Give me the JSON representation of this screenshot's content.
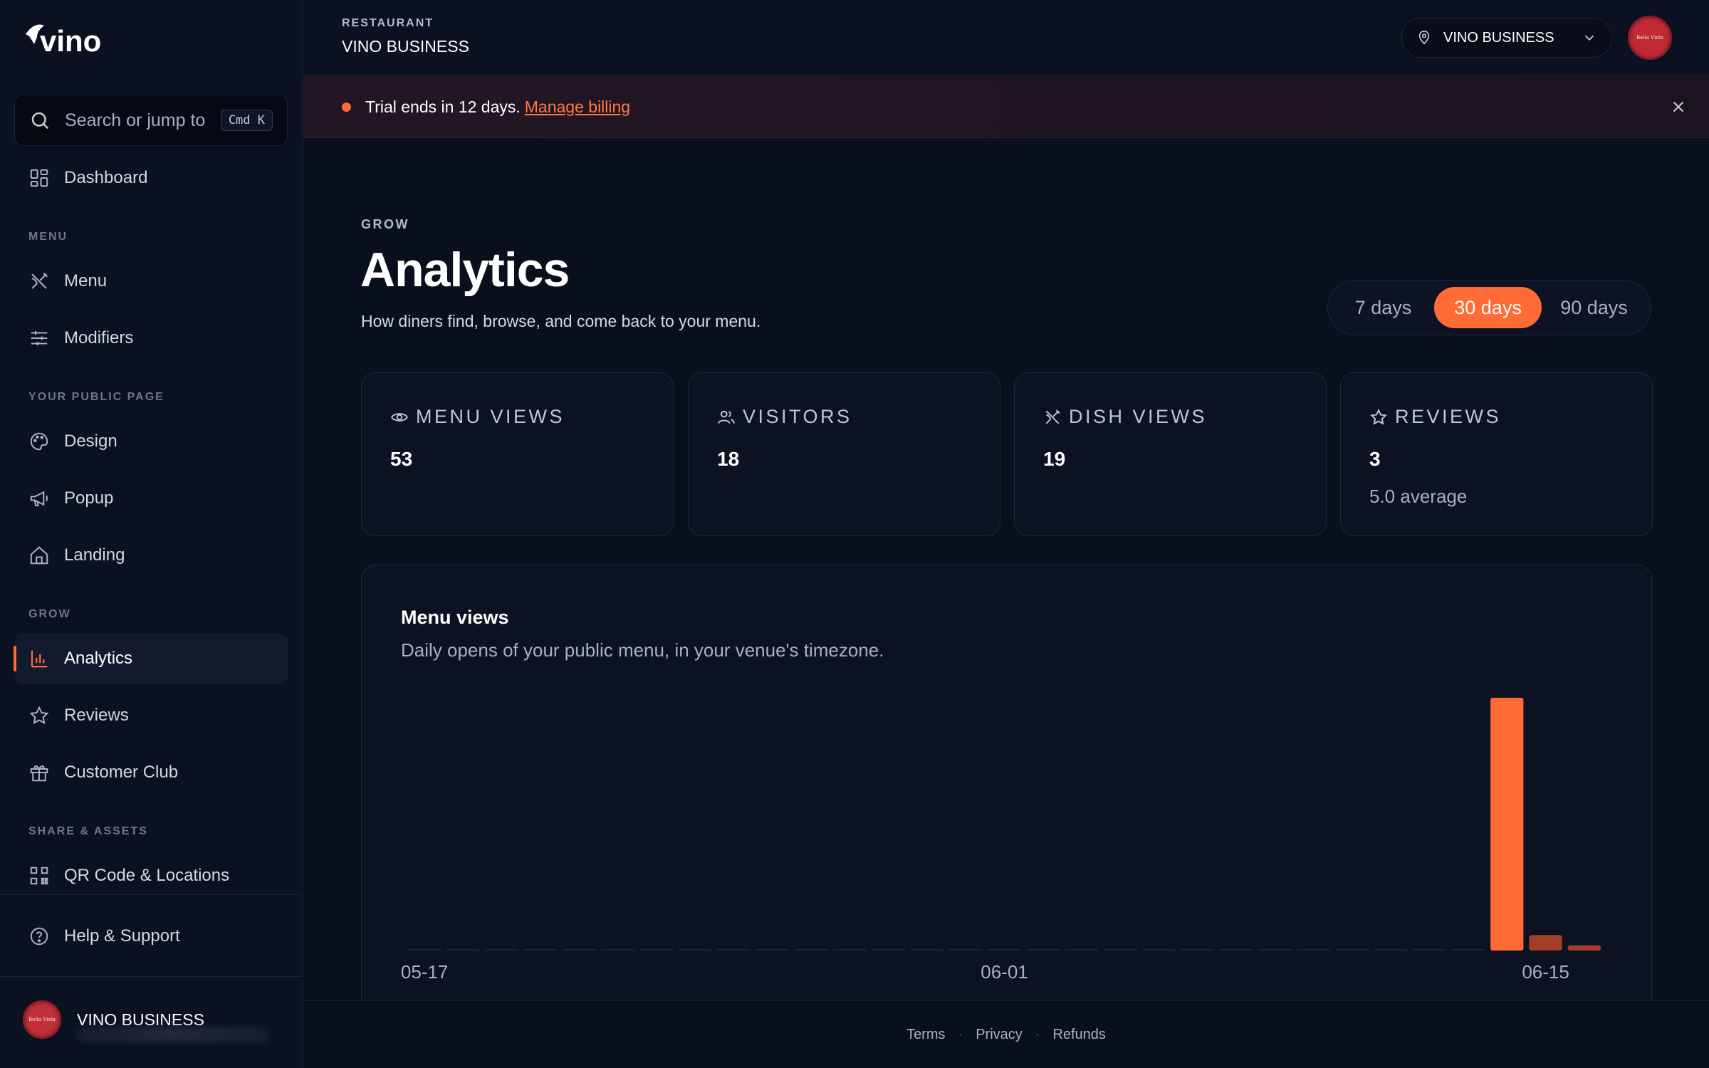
{
  "brand": {
    "logo_text": "vino",
    "accent": "#ff6b35"
  },
  "sidebar": {
    "search": {
      "placeholder": "Search or jump to",
      "shortcut": "Cmd K"
    },
    "dashboard": "Dashboard",
    "sections": {
      "menu": "MENU",
      "public_page": "YOUR PUBLIC PAGE",
      "grow": "GROW",
      "share": "SHARE & ASSETS"
    },
    "items": {
      "menu": "Menu",
      "modifiers": "Modifiers",
      "design": "Design",
      "popup": "Popup",
      "landing": "Landing",
      "analytics": "Analytics",
      "reviews": "Reviews",
      "customer_club": "Customer Club",
      "qr": "QR Code & Locations",
      "help": "Help & Support"
    },
    "active_item": "analytics",
    "user": {
      "name": "VINO BUSINESS"
    }
  },
  "topbar": {
    "label": "RESTAURANT",
    "name": "VINO BUSINESS",
    "venue_select": "VINO BUSINESS",
    "avatar_text": "Bella Vista"
  },
  "banner": {
    "text": "Trial ends in 12 days.",
    "link": "Manage billing"
  },
  "page": {
    "eyebrow": "GROW",
    "title": "Analytics",
    "subtitle": "How diners find, browse, and come back to your menu."
  },
  "range": {
    "options": [
      "7 days",
      "30 days",
      "90 days"
    ],
    "selected": "30 days"
  },
  "stats": [
    {
      "icon": "eye-icon",
      "label": "MENU VIEWS",
      "value": "53"
    },
    {
      "icon": "users-icon",
      "label": "VISITORS",
      "value": "18"
    },
    {
      "icon": "utensils-icon",
      "label": "DISH VIEWS",
      "value": "19"
    },
    {
      "icon": "star-icon",
      "label": "REVIEWS",
      "value": "3",
      "extra": "5.0 average"
    }
  ],
  "chart": {
    "title": "Menu views",
    "subtitle": "Daily opens of your public menu, in your venue's timezone."
  },
  "chart_data": {
    "type": "bar",
    "title": "Menu views",
    "tick_labels": [
      "05-17",
      "06-01",
      "06-15"
    ],
    "categories": [
      "05-17",
      "05-18",
      "05-19",
      "05-20",
      "05-21",
      "05-22",
      "05-23",
      "05-24",
      "05-25",
      "05-26",
      "05-27",
      "05-28",
      "05-29",
      "05-30",
      "05-31",
      "06-01",
      "06-02",
      "06-03",
      "06-04",
      "06-05",
      "06-06",
      "06-07",
      "06-08",
      "06-09",
      "06-10",
      "06-11",
      "06-12",
      "06-13",
      "06-14",
      "06-15",
      "06-16"
    ],
    "values": [
      0,
      0,
      0,
      0,
      0,
      0,
      0,
      0,
      0,
      0,
      0,
      0,
      0,
      0,
      0,
      0,
      0,
      0,
      0,
      0,
      0,
      0,
      0,
      0,
      0,
      0,
      0,
      0,
      49,
      3,
      1
    ],
    "colors": {
      "primary": "#ff6b35",
      "secondary": "#a23e26",
      "empty": "#1c2335"
    }
  },
  "footer": {
    "links": [
      "Terms",
      "Privacy",
      "Refunds"
    ]
  }
}
